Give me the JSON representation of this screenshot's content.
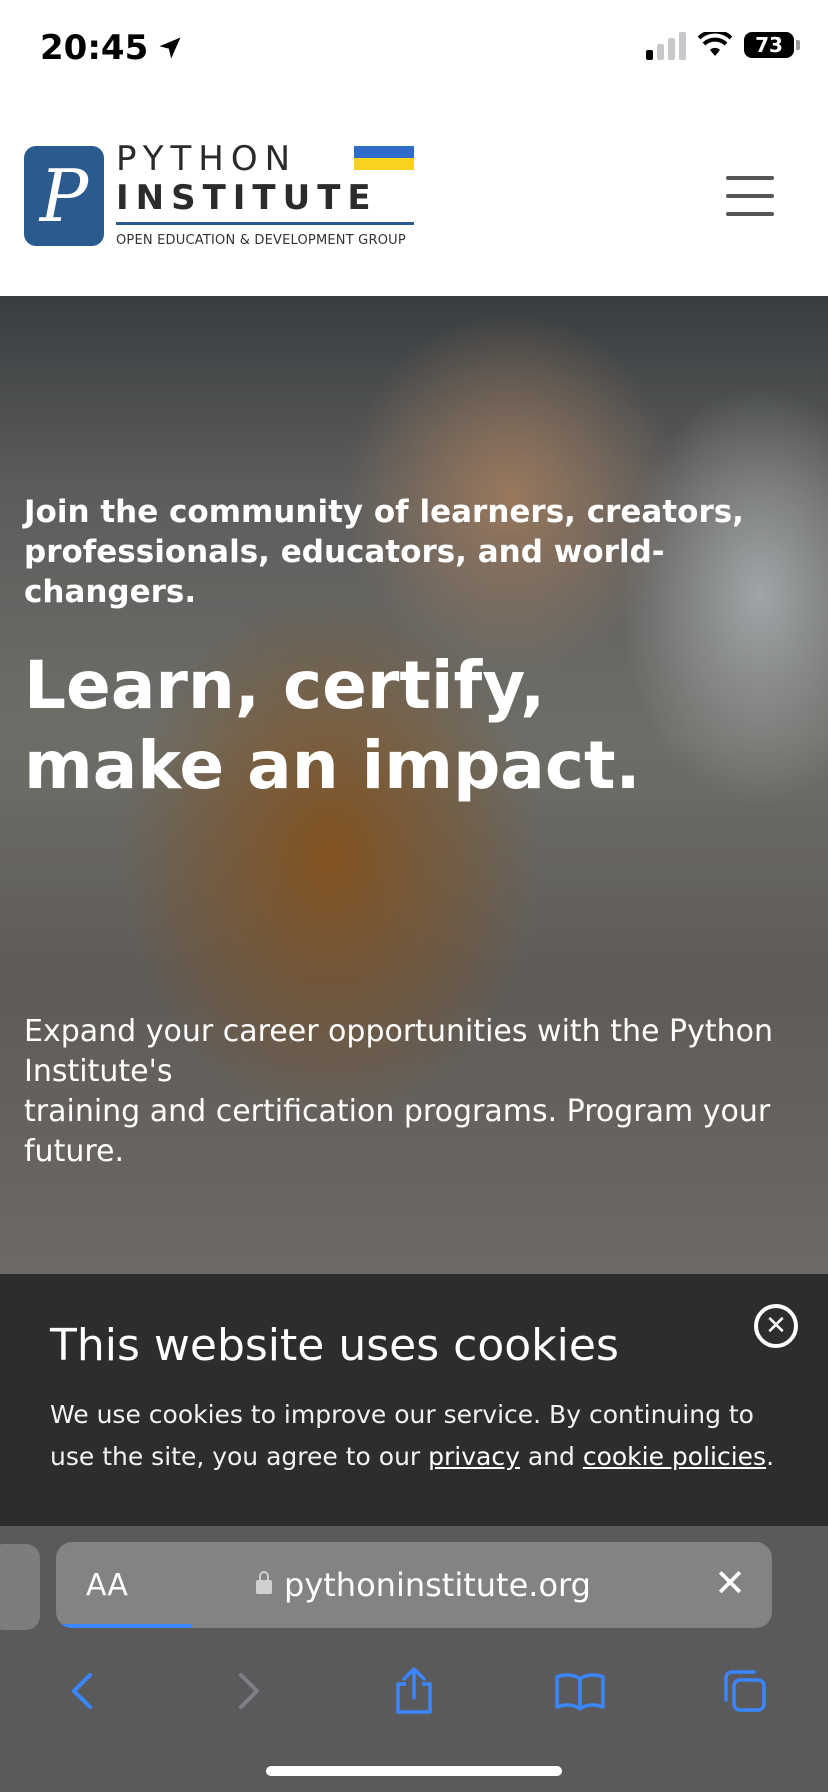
{
  "status_bar": {
    "time": "20:45",
    "battery_percent": "73"
  },
  "header": {
    "logo_letter": "P",
    "logo_line1": "PYTHON",
    "logo_line2": "INSTITUTE",
    "logo_sub": "OPEN EDUCATION & DEVELOPMENT GROUP",
    "flag_colors": [
      "#2f6cc9",
      "#f7d21f"
    ]
  },
  "hero": {
    "kicker": "Join the community of learners, creators, professionals, educators, and world-changers.",
    "title_line1": "Learn, certify,",
    "title_line2": "make an impact.",
    "body_line1": "Expand your career opportunities with the Python Institute's",
    "body_line2": "training and certification programs. Program your future."
  },
  "cookie_banner": {
    "title": "This website uses cookies",
    "text_before": "We use cookies to improve our service. By continuing to use the site, you agree to our ",
    "privacy_link": "privacy",
    "text_middle": " and ",
    "cookie_link": "cookie policies",
    "text_after": ".",
    "close_glyph": "✕"
  },
  "safari": {
    "text_size_button": "AA",
    "url": "pythoninstitute.org",
    "clear_glyph": "✕",
    "load_progress": 0.19,
    "accent_color": "#3a86ff"
  }
}
